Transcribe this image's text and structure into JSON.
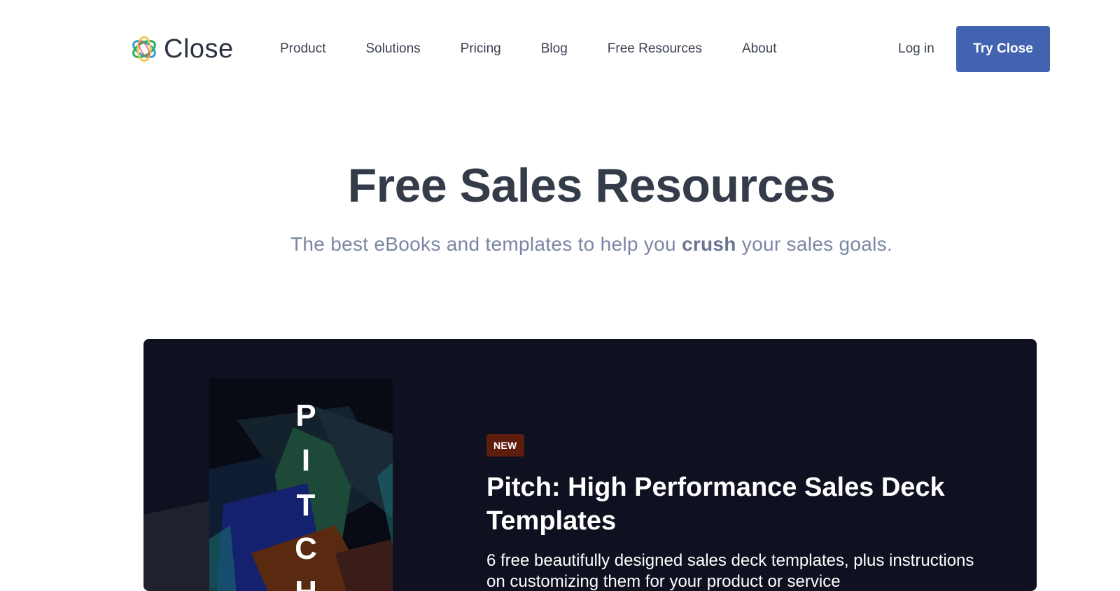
{
  "brand": {
    "name": "Close"
  },
  "nav": {
    "items": [
      "Product",
      "Solutions",
      "Pricing",
      "Blog",
      "Free Resources",
      "About"
    ],
    "login_label": "Log in",
    "cta_label": "Try Close"
  },
  "hero": {
    "title": "Free Sales Resources",
    "subtitle_before": "The best eBooks and templates to help you ",
    "subtitle_bold": "crush",
    "subtitle_after": " your sales goals."
  },
  "featured": {
    "badge": "NEW",
    "title": "Pitch: High Performance Sales Deck Templates",
    "description": "6 free beautifully designed sales deck templates, plus instructions on customizing them for your product or service",
    "cover_letters": [
      "P",
      "I",
      "T",
      "C",
      "H"
    ]
  },
  "colors": {
    "primary": "#4263b0",
    "heading": "#343c4a",
    "subtitle": "#7c86a4",
    "feature_bg": "#0f1120",
    "badge_bg": "#5e1d0d"
  }
}
